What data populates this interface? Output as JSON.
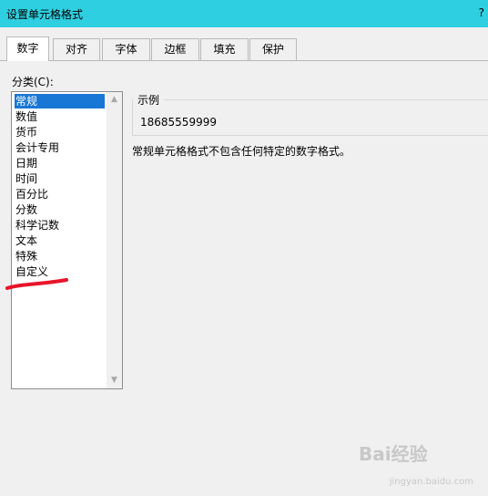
{
  "window": {
    "title": "设置单元格格式",
    "help": "?"
  },
  "tabs": [
    {
      "label": "数字",
      "active": true
    },
    {
      "label": "对齐"
    },
    {
      "label": "字体"
    },
    {
      "label": "边框"
    },
    {
      "label": "填充"
    },
    {
      "label": "保护"
    }
  ],
  "category": {
    "label": "分类(C):",
    "items": [
      "常规",
      "数值",
      "货币",
      "会计专用",
      "日期",
      "时间",
      "百分比",
      "分数",
      "科学记数",
      "文本",
      "特殊",
      "自定义"
    ],
    "selected_index": 0
  },
  "sample": {
    "legend": "示例",
    "value": "18685559999"
  },
  "description": "常规单元格格式不包含任何特定的数字格式。",
  "watermark": {
    "text": "Bai经验",
    "sub": "jingyan.baidu.com"
  },
  "colors": {
    "titlebar": "#2ecfe0",
    "selection": "#1877d4",
    "annotation": "#e8152a"
  }
}
